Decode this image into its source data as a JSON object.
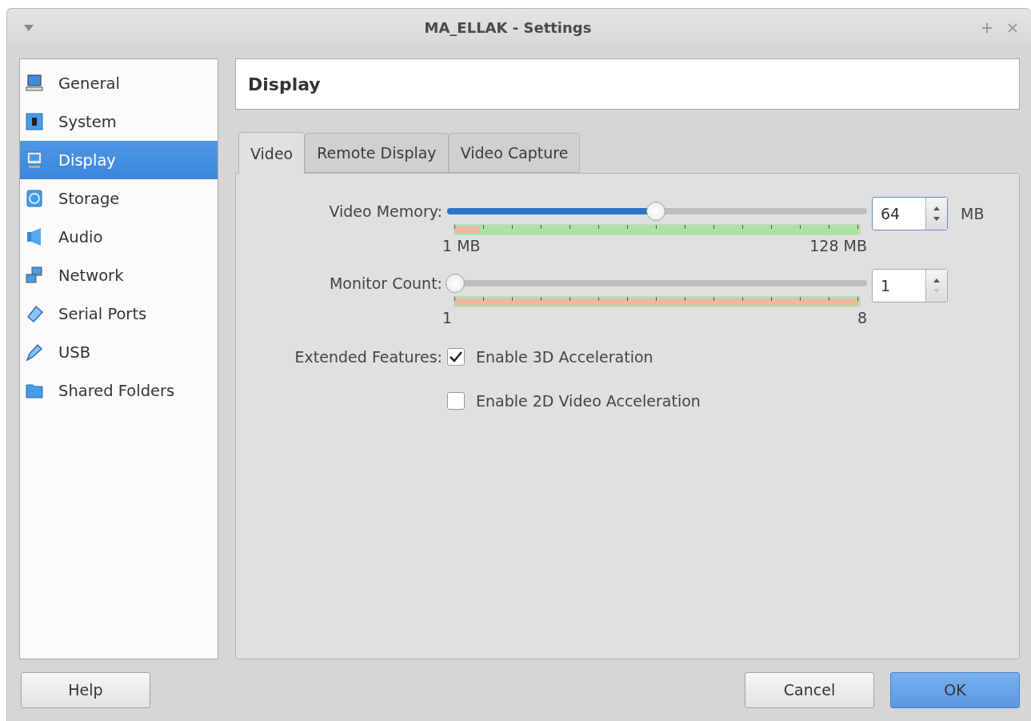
{
  "window": {
    "title": "MA_ELLAK - Settings"
  },
  "sidebar": {
    "items": [
      {
        "label": "General",
        "selected": false
      },
      {
        "label": "System",
        "selected": false
      },
      {
        "label": "Display",
        "selected": true
      },
      {
        "label": "Storage",
        "selected": false
      },
      {
        "label": "Audio",
        "selected": false
      },
      {
        "label": "Network",
        "selected": false
      },
      {
        "label": "Serial Ports",
        "selected": false
      },
      {
        "label": "USB",
        "selected": false
      },
      {
        "label": "Shared Folders",
        "selected": false
      }
    ]
  },
  "page_title": "Display",
  "tabs": [
    {
      "label": "Video",
      "selected": true
    },
    {
      "label": "Remote Display",
      "selected": false
    },
    {
      "label": "Video Capture",
      "selected": false
    }
  ],
  "sliders": [
    {
      "label": "Video Memory:",
      "level": 0.5,
      "min_label": "1 MB",
      "max_label": "128 MB",
      "scale": {
        "level": 0.06
      },
      "value": "64",
      "focused": true,
      "down_disabled": false,
      "unit": "MB"
    },
    {
      "label": "Monitor Count:",
      "level": 0,
      "min_label": "1",
      "max_label": "8",
      "scale": {
        "level": 1
      },
      "value": "1",
      "focused": false,
      "down_disabled": true
    }
  ],
  "extended_features": {
    "label": "Extended Features:",
    "options": [
      {
        "label": "Enable 3D Acceleration",
        "checked": true
      },
      {
        "label": "Enable 2D Video Acceleration",
        "checked": false
      }
    ]
  },
  "buttons": [
    {
      "label": "Help",
      "default": false
    },
    {
      "label": "Cancel",
      "default": false
    },
    {
      "label": "OK",
      "default": true
    }
  ]
}
